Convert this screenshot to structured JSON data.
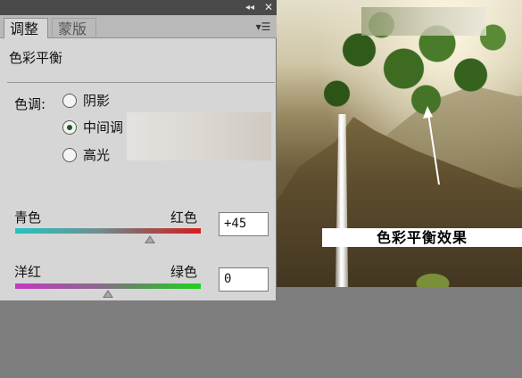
{
  "panel": {
    "tabs": [
      {
        "label": "调整",
        "active": true
      },
      {
        "label": "蒙版",
        "active": false
      }
    ],
    "window_controls": {
      "collapse": "◂◂",
      "close": "✕"
    },
    "menu_icon": "panel-menu-icon",
    "title": "色彩平衡",
    "tone": {
      "label": "色调:",
      "options": [
        {
          "label": "阴影",
          "checked": false
        },
        {
          "label": "中间调",
          "checked": true
        },
        {
          "label": "高光",
          "checked": false
        }
      ]
    },
    "sliders": [
      {
        "left_label": "青色",
        "right_label": "红色",
        "value": "+45",
        "numeric": 45,
        "range": [
          -100,
          100
        ]
      },
      {
        "left_label": "洋红",
        "right_label": "绿色",
        "value": "0",
        "numeric": 0,
        "range": [
          -100,
          100
        ]
      }
    ]
  },
  "photo": {
    "caption": "色彩平衡效果"
  },
  "colors": {
    "panel_bg": "#d6d6d6",
    "titlebar_bg": "#4a4a4a",
    "cyan": "#22c4c4",
    "red": "#d81c1c",
    "magenta": "#c23ac2",
    "green": "#1fd21f"
  }
}
